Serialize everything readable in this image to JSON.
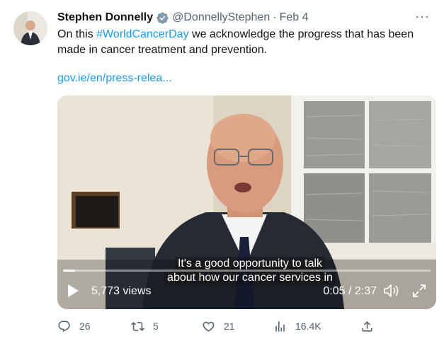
{
  "author": {
    "name": "Stephen Donnelly",
    "handle": "@DonnellyStephen",
    "separator": "·",
    "date": "Feb 4"
  },
  "tweet": {
    "text_before": "On this ",
    "hashtag": "#WorldCancerDay",
    "text_after": " we acknowledge the progress that has been made in cancer treatment and prevention.",
    "link": "gov.ie/en/press-relea..."
  },
  "video": {
    "caption_line1": "It's a good opportunity to talk",
    "caption_line2": "about how our cancer services in",
    "views": "5,773 views",
    "time": "0:05 / 2:37",
    "progress_fraction": 0.032
  },
  "actions": {
    "replies": "26",
    "retweets": "5",
    "likes": "21",
    "views": "16.4K"
  },
  "icons": {
    "verified": "verified-badge-icon",
    "more": "more-icon",
    "play": "play-icon",
    "volume": "volume-icon",
    "fullscreen": "fullscreen-icon",
    "reply": "reply-icon",
    "retweet": "retweet-icon",
    "like": "heart-icon",
    "analytics": "analytics-icon",
    "share": "share-icon"
  },
  "colors": {
    "link": "#1d9bf0",
    "muted": "#536471",
    "text": "#0f1419"
  }
}
